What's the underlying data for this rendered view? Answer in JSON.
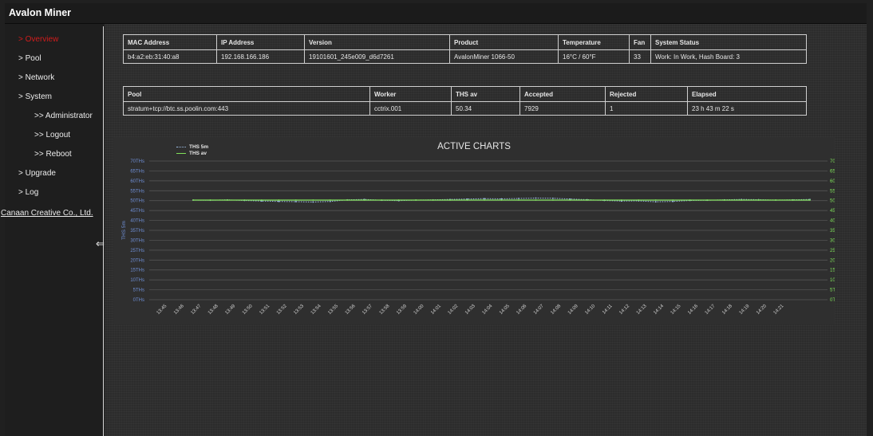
{
  "app": {
    "title": "Avalon Miner"
  },
  "sidebar": {
    "items": [
      {
        "label": "> Overview",
        "active": true
      },
      {
        "label": "> Pool"
      },
      {
        "label": "> Network"
      },
      {
        "label": "> System"
      },
      {
        "label": ">> Administrator"
      },
      {
        "label": ">> Logout"
      },
      {
        "label": ">> Reboot"
      },
      {
        "label": "> Upgrade"
      },
      {
        "label": "> Log"
      }
    ],
    "company": "Canaan Creative Co., Ltd.",
    "collapse_icon": "⇐"
  },
  "status_table": {
    "headers": [
      "MAC Address",
      "IP Address",
      "Version",
      "Product",
      "Temperature",
      "Fan",
      "System Status"
    ],
    "row": [
      "b4:a2:eb:31:40:a8",
      "192.168.166.186",
      "19101601_245e009_d6d7261",
      "AvalonMiner 1066-50",
      "16°C / 60°F",
      "33",
      "Work: In Work, Hash Board: 3"
    ]
  },
  "pool_table": {
    "headers": [
      "Pool",
      "Worker",
      "THS av",
      "Accepted",
      "Rejected",
      "Elapsed"
    ],
    "row": [
      "stratum+tcp://btc.ss.poolin.com:443",
      "cctrix.001",
      "50.34",
      "7929",
      "1",
      "23 h 43 m 22 s"
    ]
  },
  "chart_data": {
    "type": "line",
    "title": "ACTIVE CHARTS",
    "ylabel_left": "THS 5m",
    "ylabel_right": "THS av",
    "ylim": [
      0,
      70
    ],
    "y_ticks": [
      "0THs",
      "5THs",
      "10THs",
      "15THs",
      "20THs",
      "25THs",
      "30THs",
      "35THs",
      "40THs",
      "45THs",
      "50THs",
      "55THs",
      "60THs",
      "65THs",
      "70THs"
    ],
    "x": [
      "13:45",
      "13:46",
      "13:47",
      "13:48",
      "13:49",
      "13:50",
      "13:51",
      "13:52",
      "13:53",
      "13:54",
      "13:55",
      "13:56",
      "13:57",
      "13:58",
      "13:59",
      "14:00",
      "14:01",
      "14:02",
      "14:03",
      "14:04",
      "14:05",
      "14:06",
      "14:07",
      "14:08",
      "14:09",
      "14:10",
      "14:11",
      "14:12",
      "14:13",
      "14:14",
      "14:15",
      "14:16",
      "14:17",
      "14:18",
      "14:19",
      "14:20",
      "14:21"
    ],
    "legend_position": "top-left",
    "grid": true,
    "series": [
      {
        "name": "THS 5m",
        "color": "#9fc0e8",
        "style": "dotted",
        "values": [
          50.3,
          50.2,
          50.4,
          50.1,
          49.8,
          49.6,
          49.5,
          49.3,
          49.6,
          50.4,
          50.6,
          50.2,
          50.0,
          50.3,
          50.4,
          50.6,
          50.8,
          51.0,
          50.9,
          51.1,
          51.3,
          51.2,
          50.8,
          50.5,
          50.1,
          49.8,
          49.9,
          49.4,
          49.6,
          50.1,
          50.2,
          50.4,
          50.6,
          50.5,
          50.3,
          50.4,
          50.6
        ]
      },
      {
        "name": "THS av",
        "color": "#7fe05a",
        "style": "solid",
        "values": [
          50.3,
          50.3,
          50.3,
          50.3,
          50.3,
          50.3,
          50.3,
          50.3,
          50.3,
          50.3,
          50.3,
          50.3,
          50.3,
          50.3,
          50.3,
          50.3,
          50.3,
          50.3,
          50.3,
          50.3,
          50.3,
          50.3,
          50.3,
          50.3,
          50.3,
          50.3,
          50.3,
          50.3,
          50.3,
          50.3,
          50.3,
          50.3,
          50.3,
          50.3,
          50.3,
          50.3,
          50.3
        ]
      }
    ]
  },
  "colors": {
    "accent_active": "#d11c1c",
    "left_axis": "#6f8fd6",
    "right_axis": "#7fe05a"
  }
}
